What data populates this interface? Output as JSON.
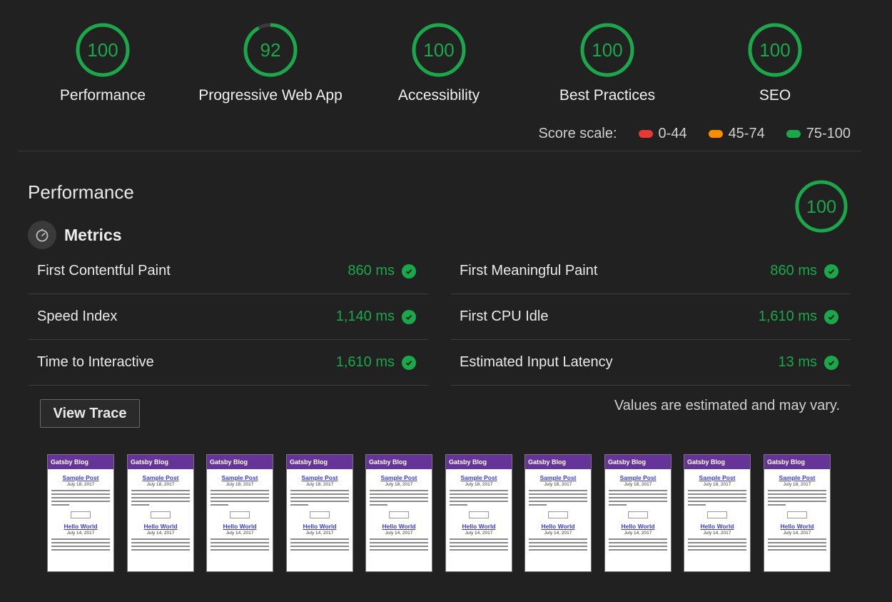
{
  "gauges": [
    {
      "score": 100,
      "label": "Performance"
    },
    {
      "score": 92,
      "label": "Progressive Web App"
    },
    {
      "score": 100,
      "label": "Accessibility"
    },
    {
      "score": 100,
      "label": "Best Practices"
    },
    {
      "score": 100,
      "label": "SEO"
    }
  ],
  "score_scale": {
    "label": "Score scale:",
    "ranges": [
      {
        "text": "0-44",
        "color": "#e53935"
      },
      {
        "text": "45-74",
        "color": "#fb8c00"
      },
      {
        "text": "75-100",
        "color": "#1aa84a"
      }
    ]
  },
  "colors": {
    "pass": "#1aa84a",
    "track": "#3a3a3a"
  },
  "performance": {
    "title": "Performance",
    "score": 100,
    "metrics_label": "Metrics",
    "metrics_icon": "stopwatch-icon",
    "left_metrics": [
      {
        "name": "First Contentful Paint",
        "value": "860 ms"
      },
      {
        "name": "Speed Index",
        "value": "1,140 ms"
      },
      {
        "name": "Time to Interactive",
        "value": "1,610 ms"
      }
    ],
    "right_metrics": [
      {
        "name": "First Meaningful Paint",
        "value": "860 ms"
      },
      {
        "name": "First CPU Idle",
        "value": "1,610 ms"
      },
      {
        "name": "Estimated Input Latency",
        "value": "13 ms"
      }
    ],
    "view_trace_label": "View Trace",
    "note": "Values are estimated and may vary."
  },
  "filmstrip": {
    "frame_count": 10,
    "frame": {
      "site_title": "Gatsby Blog",
      "post1_title": "Sample Post",
      "post1_date": "July 18, 2017",
      "post2_title": "Hello World",
      "post2_date": "July 14, 2017"
    }
  }
}
